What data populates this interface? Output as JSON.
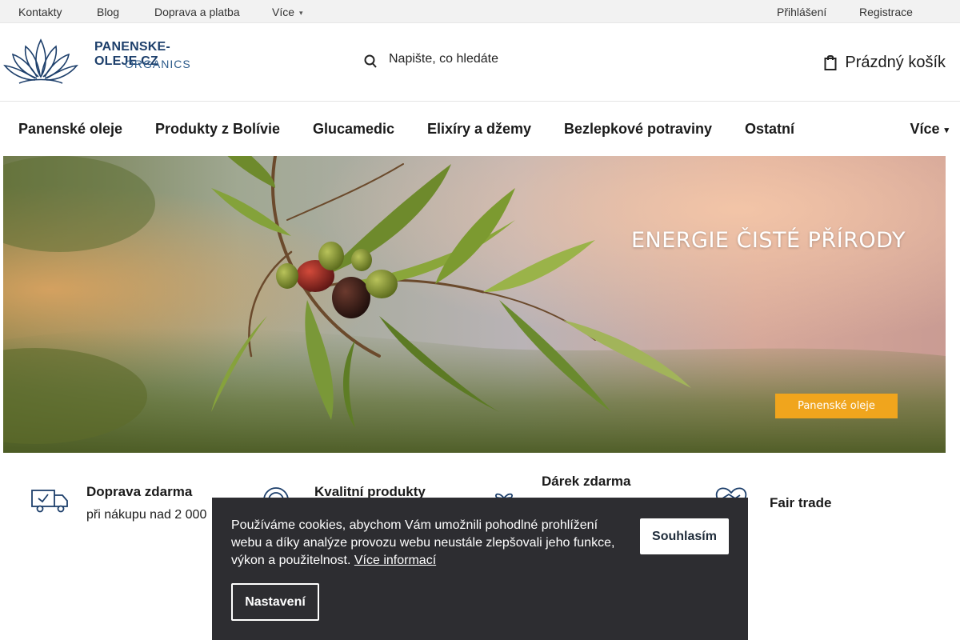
{
  "topbar": {
    "links": [
      "Kontakty",
      "Blog",
      "Doprava a platba"
    ],
    "more_label": "Více",
    "login_label": "Přihlášení",
    "register_label": "Registrace"
  },
  "header": {
    "logo_line1": "PANENSKE-OLEJE.CZ",
    "logo_line2": "ORGANICS",
    "search_placeholder": "Napište, co hledáte",
    "cart_label": "Prázdný košík"
  },
  "nav": {
    "items": [
      "Panenské oleje",
      "Produkty z Bolívie",
      "Glucamedic",
      "Elixíry a džemy",
      "Bezlepkové potraviny",
      "Ostatní"
    ],
    "more_label": "Více"
  },
  "hero": {
    "title": "ENERGIE ČISTÉ PŘÍRODY",
    "button_label": "Panenské oleje"
  },
  "benefits": [
    {
      "title": "Doprava zdarma",
      "desc": "při nákupu nad 2 000",
      "icon": "delivery-truck-icon"
    },
    {
      "title": "Kvalitní produkty",
      "desc": "",
      "icon": "quality-badge-icon"
    },
    {
      "title": "Dárek zdarma",
      "desc": "",
      "icon": "gift-icon"
    },
    {
      "title": "Fair trade",
      "desc": "",
      "icon": "handshake-heart-icon"
    }
  ],
  "cookie": {
    "text": "Používáme cookies, abychom Vám umožnili pohodlné prohlížení webu a díky analýze provozu webu neustále zlepšovali jeho funkce, výkon a použitelnost.",
    "more_info_label": "Více informací",
    "accept_label": "Souhlasím",
    "settings_label": "Nastavení"
  },
  "colors": {
    "brand_navy": "#1d3f6b",
    "accent_orange": "#f0a51d",
    "cookie_bg": "#2d2d31"
  }
}
